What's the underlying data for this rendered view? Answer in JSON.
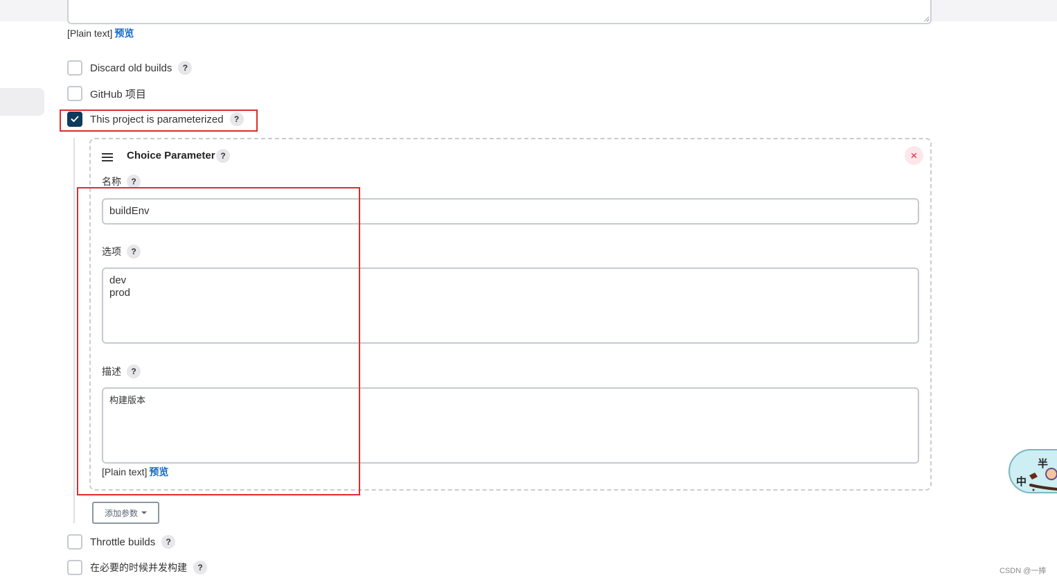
{
  "top_plain": {
    "label": "[Plain text]",
    "preview": "预览"
  },
  "options": [
    {
      "label": "Discard old builds",
      "checked": false,
      "has_help": true
    },
    {
      "label": "GitHub 项目",
      "checked": false,
      "has_help": false
    },
    {
      "label": "This project is parameterized",
      "checked": true,
      "has_help": true
    }
  ],
  "param": {
    "title": "Choice Parameter",
    "delete": "×",
    "name_label": "名称",
    "name_value": "buildEnv",
    "choices_label": "选项",
    "choices_value": "dev\nprod",
    "desc_label": "描述",
    "desc_value": "构建版本",
    "plain": "[Plain text]",
    "preview": "预览"
  },
  "add_param_label": "添加参数",
  "bottom_options": [
    {
      "label": "Throttle builds",
      "checked": false
    },
    {
      "label": "在必要的时候并发构建",
      "checked": false
    }
  ],
  "help_glyph": "?",
  "mascot": {
    "char_ban": "半",
    "char_zhong": "中"
  },
  "watermark": "CSDN @一捧",
  "colors": {
    "checkbox_checked": "#0e3a5c",
    "link": "#1469c8",
    "annotation_red": "#e02b2b",
    "delete_red": "#e0283c"
  }
}
